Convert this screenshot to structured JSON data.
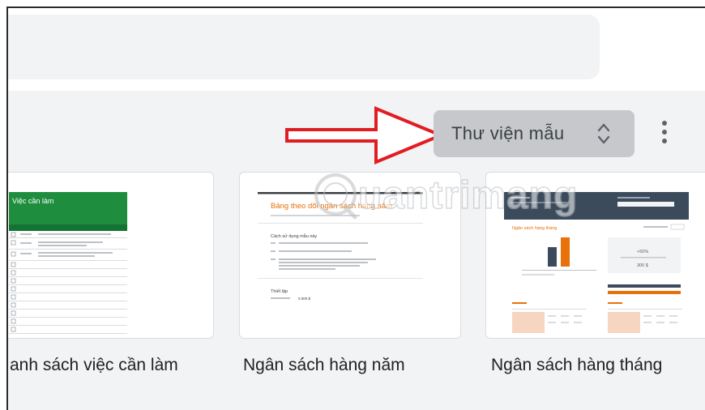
{
  "toolbar": {
    "template_gallery_label": "Thư viện mẫu",
    "more_icon": "more-vert-icon",
    "expand_icon": "unfold-more-icon"
  },
  "annotation": {
    "arrow_color": "#e11d24"
  },
  "templates": [
    {
      "title": "anh sách việc cần làm",
      "thumb_heading": "Việc cần làm",
      "thumb_header_color": "#1e8e3e"
    },
    {
      "title": "Ngân sách hàng năm",
      "thumb_heading": "Bảng theo dõi ngân sách hàng năm",
      "thumb_section": "Cách sử dụng mẫu này",
      "thumb_subsection": "Thiết lập",
      "thumb_value": "0.000 $",
      "thumb_accent_color": "#e8710a"
    },
    {
      "title": "Ngân sách hàng tháng",
      "thumb_heading": "Ngân sách hàng tháng",
      "thumb_percent": "+50%",
      "thumb_amount": "300 $",
      "thumb_header_color": "#3c4b5c",
      "thumb_accent_color": "#e8710a"
    }
  ],
  "watermark": {
    "text": "uantrimang"
  }
}
